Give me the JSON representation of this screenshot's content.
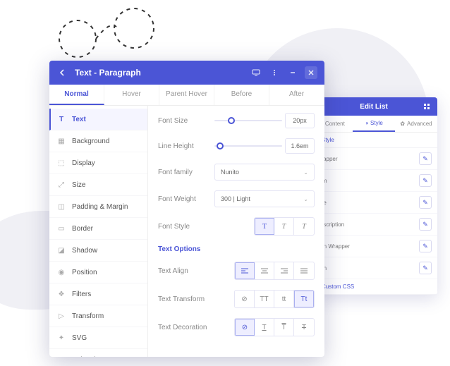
{
  "panel": {
    "title": "Text - Paragraph",
    "tabs": [
      "Normal",
      "Hover",
      "Parent Hover",
      "Before",
      "After"
    ],
    "sidebar": [
      {
        "label": "Text",
        "icon": "text-icon"
      },
      {
        "label": "Background",
        "icon": "background-icon"
      },
      {
        "label": "Display",
        "icon": "display-icon"
      },
      {
        "label": "Size",
        "icon": "size-icon"
      },
      {
        "label": "Padding & Margin",
        "icon": "padding-margin-icon"
      },
      {
        "label": "Border",
        "icon": "border-icon"
      },
      {
        "label": "Shadow",
        "icon": "shadow-icon"
      },
      {
        "label": "Position",
        "icon": "position-icon"
      },
      {
        "label": "Filters",
        "icon": "filters-icon"
      },
      {
        "label": "Transform",
        "icon": "transform-icon"
      },
      {
        "label": "SVG",
        "icon": "svg-icon"
      },
      {
        "label": "Animation",
        "icon": "animation-icon"
      }
    ],
    "rows": {
      "font_size": {
        "label": "Font Size",
        "value": "20px"
      },
      "line_height": {
        "label": "Line Height",
        "value": "1.6em"
      },
      "font_family": {
        "label": "Font family",
        "value": "Nunito"
      },
      "font_weight": {
        "label": "Font Weight",
        "value": "300 | Light"
      },
      "font_style": {
        "label": "Font Style",
        "options": [
          "T",
          "T",
          "T"
        ]
      },
      "text_options": "Text Options",
      "text_align": {
        "label": "Text Align"
      },
      "text_transform": {
        "label": "Text Transform",
        "options": [
          "⊘",
          "TT",
          "tt",
          "Tt"
        ]
      },
      "text_decoration": {
        "label": "Text Decoration"
      }
    }
  },
  "editlist": {
    "title": "Edit List",
    "tabs": [
      {
        "label": "Content",
        "icon": "pencil-icon"
      },
      {
        "label": "Style",
        "icon": "palette-icon"
      },
      {
        "label": "Advanced",
        "icon": "gear-icon"
      }
    ],
    "section": "Style",
    "rows": [
      "Wrapper",
      "Item",
      "Title",
      "Description",
      "Icon Wrapper",
      "Icon"
    ],
    "custom_css": "Custom CSS"
  }
}
